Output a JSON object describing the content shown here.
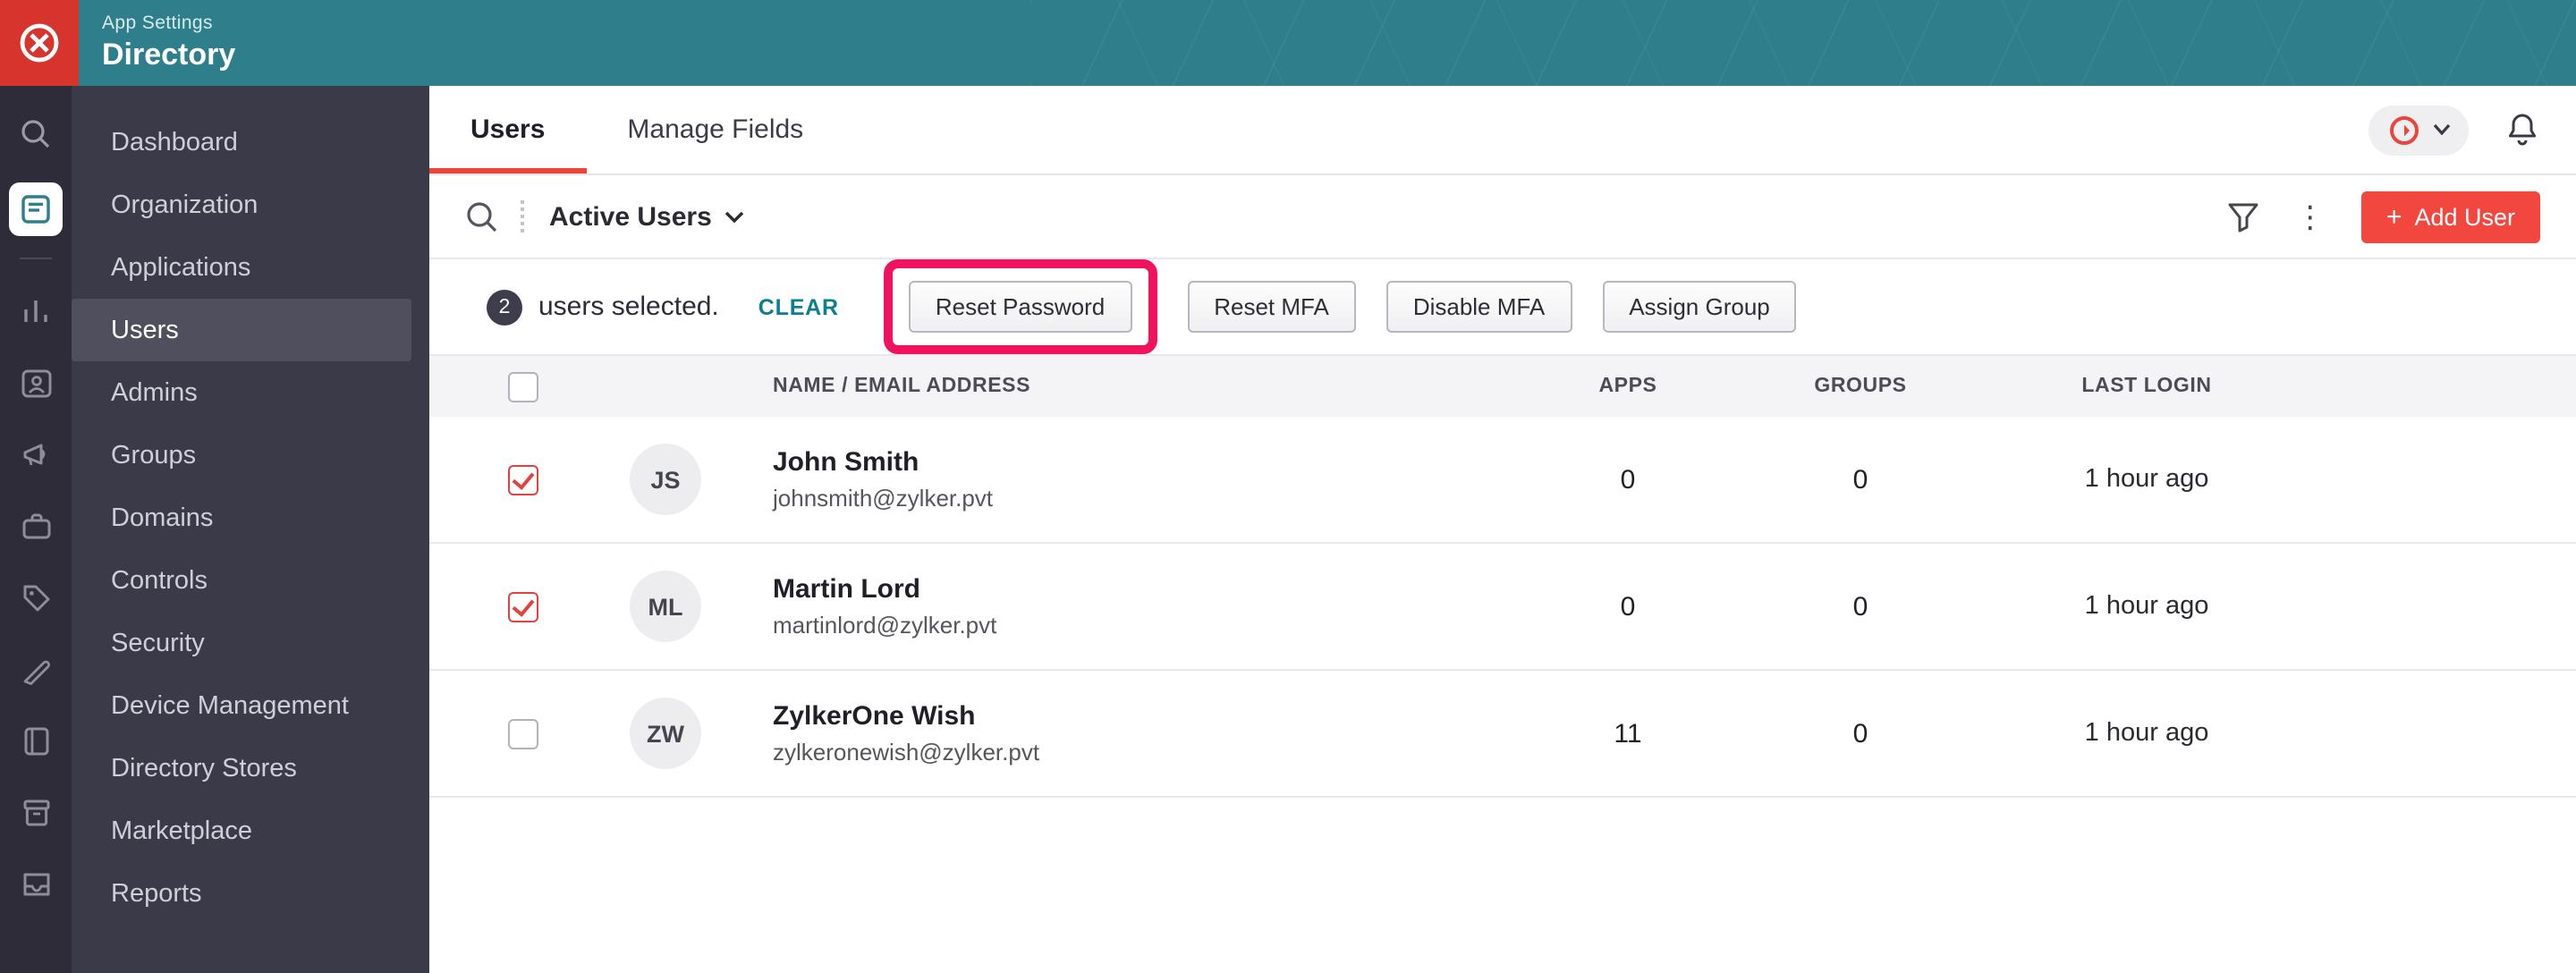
{
  "topbar": {
    "app_settings": "App Settings",
    "title": "Directory"
  },
  "rail": {
    "icons": [
      "search",
      "app-active-directory",
      "analytics",
      "contacts",
      "announcement",
      "briefcase",
      "tag",
      "design-pen",
      "book",
      "archive-box",
      "inbox-tray"
    ]
  },
  "sidebar": {
    "items": [
      "Dashboard",
      "Organization",
      "Applications",
      "Users",
      "Admins",
      "Groups",
      "Domains",
      "Controls",
      "Security",
      "Device Management",
      "Directory Stores",
      "Marketplace",
      "Reports"
    ],
    "selected": "Users"
  },
  "tabs": {
    "users": "Users",
    "manage_fields": "Manage Fields"
  },
  "toolbar": {
    "view_filter": "Active Users",
    "add_user_plus": "+",
    "add_user": "Add User"
  },
  "selection": {
    "count": "2",
    "label": "users selected.",
    "clear": "CLEAR",
    "actions": {
      "reset_password": "Reset Password",
      "reset_mfa": "Reset MFA",
      "disable_mfa": "Disable MFA",
      "assign_group": "Assign Group"
    },
    "highlighted_action": "Reset Password"
  },
  "table": {
    "headers": {
      "name": "NAME / EMAIL ADDRESS",
      "apps": "APPS",
      "groups": "GROUPS",
      "last_login": "LAST LOGIN"
    },
    "rows": [
      {
        "checked": true,
        "initials": "JS",
        "name": "John Smith",
        "email": "johnsmith@zylker.pvt",
        "apps": "0",
        "groups": "0",
        "last_login": "1 hour ago"
      },
      {
        "checked": true,
        "initials": "ML",
        "name": "Martin Lord",
        "email": "martinlord@zylker.pvt",
        "apps": "0",
        "groups": "0",
        "last_login": "1 hour ago"
      },
      {
        "checked": false,
        "initials": "ZW",
        "name": "ZylkerOne Wish",
        "email": "zylkeronewish@zylker.pvt",
        "apps": "11",
        "groups": "0",
        "last_login": "1 hour ago"
      }
    ]
  },
  "colors": {
    "topbar_teal": "#2e7e8b",
    "brand_red": "#d6342c",
    "accent_red": "#f2473f",
    "tab_underline_red": "#ef4339",
    "annotation_pink": "#f0135c",
    "link_teal": "#0b7f8d"
  }
}
